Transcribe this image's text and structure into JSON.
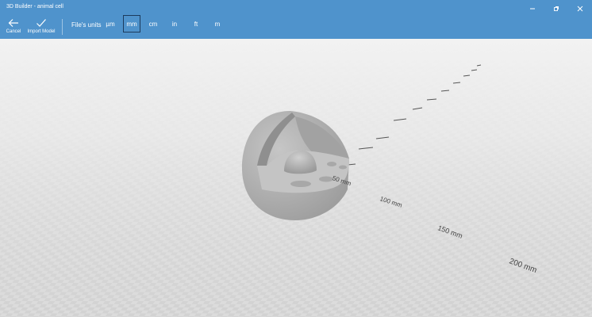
{
  "window": {
    "title": "3D Builder - animal cell"
  },
  "toolbar": {
    "cancel_label": "Cancel",
    "import_label": "Import Model",
    "units_label": "File's units",
    "units": [
      "µm",
      "mm",
      "cm",
      "in",
      "ft",
      "m"
    ],
    "selected_unit": "mm"
  },
  "ruler": {
    "labels": [
      "50 mm",
      "100 mm",
      "150 mm",
      "200 mm"
    ]
  },
  "colors": {
    "accent": "#4f93cc",
    "model": "#b0b0b0"
  }
}
